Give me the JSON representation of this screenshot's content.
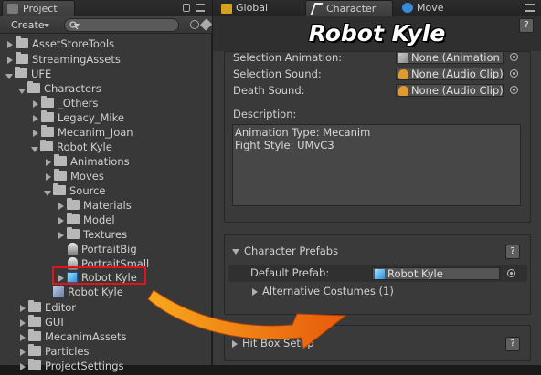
{
  "project_panel": {
    "tab_label": "Project",
    "create_label": "Create",
    "search": {
      "placeholder": ""
    },
    "tree": [
      {
        "label": "AssetStoreTools"
      },
      {
        "label": "StreamingAssets"
      },
      {
        "label": "UFE"
      },
      {
        "label": "Characters"
      },
      {
        "label": "_Others"
      },
      {
        "label": "Legacy_Mike"
      },
      {
        "label": "Mecanim_Joan"
      },
      {
        "label": "Robot Kyle"
      },
      {
        "label": "Animations"
      },
      {
        "label": "Moves"
      },
      {
        "label": "Source"
      },
      {
        "label": "Materials"
      },
      {
        "label": "Model"
      },
      {
        "label": "Textures"
      },
      {
        "label": "PortraitBig"
      },
      {
        "label": "PortraitSmall"
      },
      {
        "label": "Robot Kyle"
      },
      {
        "label": "Robot Kyle"
      },
      {
        "label": "Editor"
      },
      {
        "label": "GUI"
      },
      {
        "label": "MecanimAssets"
      },
      {
        "label": "Particles"
      },
      {
        "label": "ProjectSettings"
      }
    ]
  },
  "inspector": {
    "tabs": [
      {
        "label": "Global"
      },
      {
        "label": "Character"
      },
      {
        "label": "Move"
      }
    ],
    "title": "Robot Kyle",
    "help": "?",
    "fields": {
      "selection_animation": {
        "label": "Selection Animation:",
        "value": "None (Animation C"
      },
      "selection_sound": {
        "label": "Selection Sound:",
        "value": "None (Audio Clip)"
      },
      "death_sound": {
        "label": "Death Sound:",
        "value": "None (Audio Clip)"
      }
    },
    "description": {
      "label": "Description:",
      "line1": "Animation Type: Mecanim",
      "line2": "Fight Style: UMvC3"
    },
    "character_prefabs": {
      "header": "Character Prefabs",
      "default_prefab_label": "Default Prefab:",
      "default_prefab_value": "Robot Kyle",
      "alternative_costumes": "Alternative Costumes (1)"
    },
    "hit_box_setup": {
      "header": "Hit Box Setup"
    }
  },
  "colors": {
    "highlight": "#e0141a",
    "arrow": "#f07a10",
    "accent_blue": "#2f8fd6"
  }
}
